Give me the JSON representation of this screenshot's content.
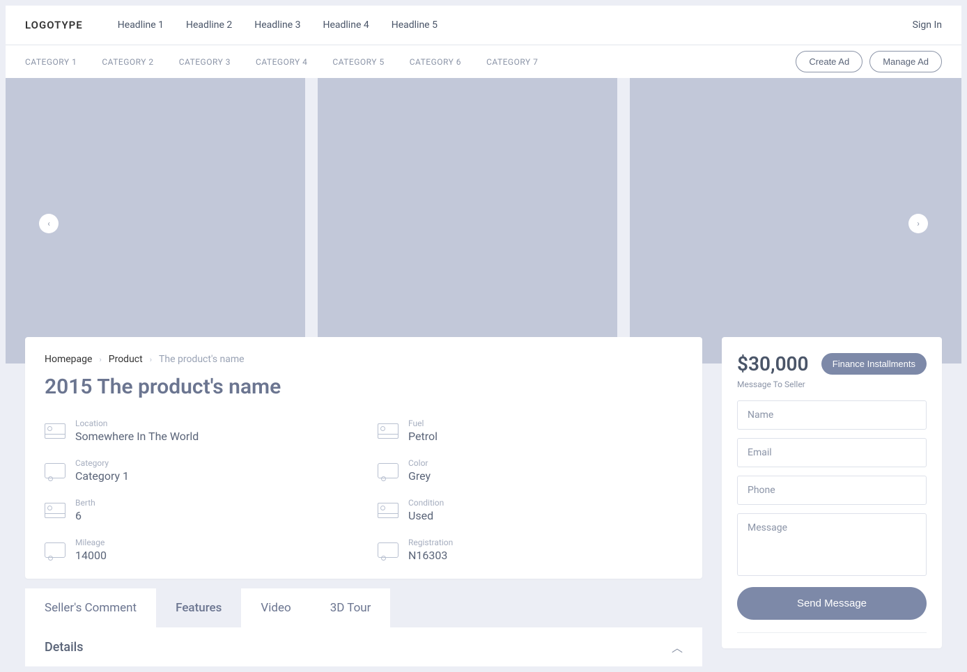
{
  "header": {
    "logo": "LOGOTYPE",
    "headlines": [
      "Headline 1",
      "Headline 2",
      "Headline 3",
      "Headline 4",
      "Headline 5"
    ],
    "signin": "Sign In",
    "categories": [
      "CATEGORY 1",
      "CATEGORY 2",
      "CATEGORY 3",
      "CATEGORY 4",
      "CATEGORY 5",
      "CATEGORY 6",
      "CATEGORY 7"
    ],
    "create_ad": "Create Ad",
    "manage_ad": "Manage Ad"
  },
  "breadcrumb": {
    "home": "Homepage",
    "product": "Product",
    "current": "The product's name"
  },
  "product": {
    "title": "2015 The product's name",
    "specs": [
      {
        "label": "Location",
        "value": "Somewhere In The World",
        "icon": "bed"
      },
      {
        "label": "Fuel",
        "value": "Petrol",
        "icon": "bed"
      },
      {
        "label": "Category",
        "value": "Category 1",
        "icon": "van"
      },
      {
        "label": "Color",
        "value": "Grey",
        "icon": "van"
      },
      {
        "label": "Berth",
        "value": "6",
        "icon": "bed"
      },
      {
        "label": "Condition",
        "value": "Used",
        "icon": "bed"
      },
      {
        "label": "Mileage",
        "value": "14000",
        "icon": "van"
      },
      {
        "label": "Registration",
        "value": "N16303",
        "icon": "van"
      }
    ]
  },
  "tabs": [
    "Seller's Comment",
    "Features",
    "Video",
    "3D Tour"
  ],
  "active_tab": 1,
  "details_title": "Details",
  "sidebar": {
    "price": "$30,000",
    "finance": "Finance Installments",
    "msg_label": "Message To Seller",
    "name_ph": "Name",
    "email_ph": "Email",
    "phone_ph": "Phone",
    "message_ph": "Message",
    "send": "Send Message"
  }
}
